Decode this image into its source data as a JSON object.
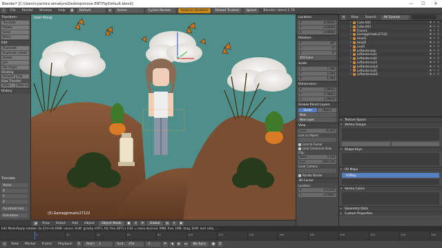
{
  "window": {
    "title": "Blender* [C:\\Users\\cyachira almakyra\\Desktop\\move ENT\\Fig\\Default.blend]",
    "minimize": "—",
    "maximize": "☐",
    "close": "✕"
  },
  "info": {
    "menus": [
      "File",
      "Render",
      "Window",
      "Help"
    ],
    "layout": "Default",
    "scene": "Scene",
    "engine": "Cycles Render",
    "warning": "Autorun disabled",
    "reload": "Reload Trusted",
    "ignore": "Ignore",
    "version": "Blender: blend 2.79"
  },
  "shelf": {
    "transform_title": "Transform",
    "transform_buttons": [
      "Translate",
      "Rotate",
      "Scale",
      "Mirror"
    ],
    "edit_title": "Edit",
    "edit_buttons": [
      "Duplicate",
      "Duplicate Linked",
      "Delete",
      "Join"
    ],
    "set_origin": "Set Origin",
    "shading_title": "Shading:",
    "smooth": "Smooth",
    "flat": "Flat",
    "datatransfer_title": "Data Transfer:",
    "data": "Data",
    "data_layout": "Data Layout",
    "history_title": "History",
    "op_title": "Translate",
    "op_rows": [
      "Vector",
      "X",
      "Y",
      "Z",
      "Constraint Axis",
      "Orientation"
    ]
  },
  "viewport": {
    "view_label": "User Persp",
    "object_label": "(0) Gamejgirmatic27122",
    "menus": [
      "View",
      "Select",
      "Add",
      "Object"
    ],
    "mode": "Object Mode",
    "shading": "Global"
  },
  "npanel": {
    "location_title": "Location:",
    "location": [
      {
        "axis": "X",
        "value": "0.00000"
      },
      {
        "axis": "Y",
        "value": "0.00000"
      },
      {
        "axis": "Z",
        "value": "0.00000"
      }
    ],
    "rotation_title": "Rotation:",
    "rotation": [
      {
        "axis": "X",
        "value": "90°"
      },
      {
        "axis": "Y",
        "value": "0°"
      },
      {
        "axis": "Z",
        "value": "0°"
      }
    ],
    "rotation_mode": "XYZ Euler",
    "scale_title": "Scale:",
    "scale": [
      {
        "axis": "X",
        "value": "1.000"
      },
      {
        "axis": "Y",
        "value": "1.000"
      },
      {
        "axis": "Z",
        "value": "1.000"
      }
    ],
    "dimensions_title": "Dimensions:",
    "dimensions": [
      {
        "axis": "X",
        "value": "2.09031"
      },
      {
        "axis": "Y",
        "value": "3.74843"
      },
      {
        "axis": "Z",
        "value": "1.29638"
      }
    ],
    "grease_title": "Grease Pencil Layers",
    "tab_scene": "Scene",
    "tab_object": "Object",
    "new_button": "New",
    "new_layer": "New Layer",
    "view_title": "View",
    "lens_label": "Lens:",
    "lens_value": "35.000",
    "lock_object": "Lock to Object:",
    "lock_cursor": "Lock to Cursor",
    "lock_camera": "Lock Camera to View",
    "clip_title": "Clip:",
    "clip_start_label": "Start:",
    "clip_start": "0.100",
    "clip_end_label": "End:",
    "clip_end": "1000.000",
    "local_camera": "Local Camera:",
    "render_border": "Render Border",
    "cursor_title": "3D Cursor",
    "cursor_location": "Location:",
    "cursor": [
      {
        "axis": "X",
        "value": "0.91220"
      },
      {
        "axis": "Y",
        "value": "0.55807"
      }
    ]
  },
  "outliner": {
    "view": "View",
    "search": "Search",
    "display": "All Scenes",
    "items": [
      "Cube.002",
      "Cube.003",
      "Flame1",
      "Gamejgirmatic27122",
      "Head1",
      "Head2",
      "Leaf1",
      "LeftantennaL",
      "Leftantennal1",
      "Leftantennal2",
      "Leftantennal3",
      "LeftantennaL4",
      "Leftantennal5",
      "LeftantennaL6"
    ]
  },
  "props": {
    "sections": [
      {
        "title": "Texture Space",
        "open": false
      },
      {
        "title": "Vertex Groups",
        "open": true
      },
      {
        "title": "Shape Keys",
        "open": true
      },
      {
        "title": "UV Maps",
        "open": true
      },
      {
        "title": "Vertex Colors",
        "open": true
      },
      {
        "title": "Geometry Data",
        "open": false
      },
      {
        "title": "Custom Properties",
        "open": false
      }
    ],
    "uv_map": "UVMap"
  },
  "console": {
    "text": "Edit Mode/Apply rotation 3x (Ctrl+A) RMB: cancel, Shift: gravity (OFF), Alt: fine (OFF) | 0.01 = more decimal, RMB: free, LMB: drag, Shift: lock ratio, ..."
  },
  "timeline": {
    "menus": [
      "View",
      "Marker",
      "Frame",
      "Playback"
    ],
    "start_label": "Start:",
    "start": "1",
    "end_label": "End:",
    "end": "250",
    "current": "1",
    "sync": "No Sync",
    "frames": [
      "0",
      "20",
      "40",
      "60",
      "80",
      "100",
      "120",
      "140",
      "160",
      "180",
      "200",
      "220",
      "240",
      "260"
    ],
    "current_fraction": 0.0
  }
}
